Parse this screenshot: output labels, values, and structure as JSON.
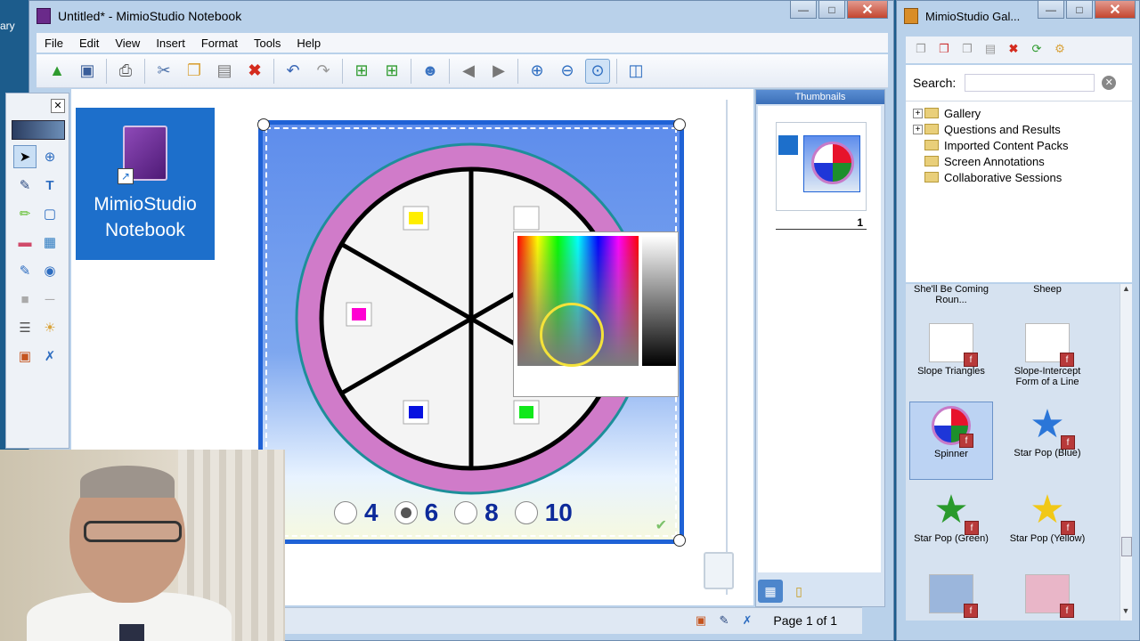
{
  "desktop": {
    "edge_text": "ary"
  },
  "main_window": {
    "title": "Untitled* - MimioStudio Notebook",
    "buttons": {
      "minimize": "—",
      "maximize": "□",
      "close": "✕"
    },
    "menu": [
      "File",
      "Edit",
      "View",
      "Insert",
      "Format",
      "Tools",
      "Help"
    ],
    "toolbar_icons": [
      "open-folder-icon",
      "save-icon",
      "print-icon",
      "cut-icon",
      "copy-icon",
      "paste-icon",
      "delete-icon",
      "undo-icon",
      "redo-icon",
      "new-page-icon",
      "duplicate-page-icon",
      "collaboration-icon",
      "back-icon",
      "forward-icon",
      "zoom-in-icon",
      "zoom-out-icon",
      "zoom-fit-icon",
      "screen-icon"
    ]
  },
  "canvas": {
    "logo_text_line1": "MimioStudio",
    "logo_text_line2": "Notebook",
    "spinner": {
      "options": [
        "4",
        "6",
        "8",
        "10"
      ],
      "selected_option": "6",
      "colors": {
        "pink_ring": "#d07bc9",
        "ring_border": "#1d8f9a",
        "yellow": "#ffee00",
        "magenta": "#ff00d2",
        "blue": "#0712e0",
        "green": "#11e81b",
        "frame": "#1f62d6"
      }
    }
  },
  "thumbnails": {
    "header": "Thumbnails",
    "page_number": "1"
  },
  "status": {
    "page_label": "Page 1 of 1"
  },
  "gallery_window": {
    "title": "MimioStudio Gal...",
    "search_label": "Search:",
    "search_value": "",
    "tree": [
      "Gallery",
      "Questions and Results",
      "Imported Content Packs",
      "Screen Annotations",
      "Collaborative Sessions"
    ],
    "items": [
      {
        "label": "She'll Be Coming Roun..."
      },
      {
        "label": "Sheep"
      },
      {
        "label": "Slope Triangles"
      },
      {
        "label": "Slope-Intercept Form of a Line"
      },
      {
        "label": "Spinner",
        "selected": true
      },
      {
        "label": "Star Pop (Blue)"
      },
      {
        "label": "Star Pop (Green)"
      },
      {
        "label": "Star Pop (Yellow)"
      }
    ]
  }
}
